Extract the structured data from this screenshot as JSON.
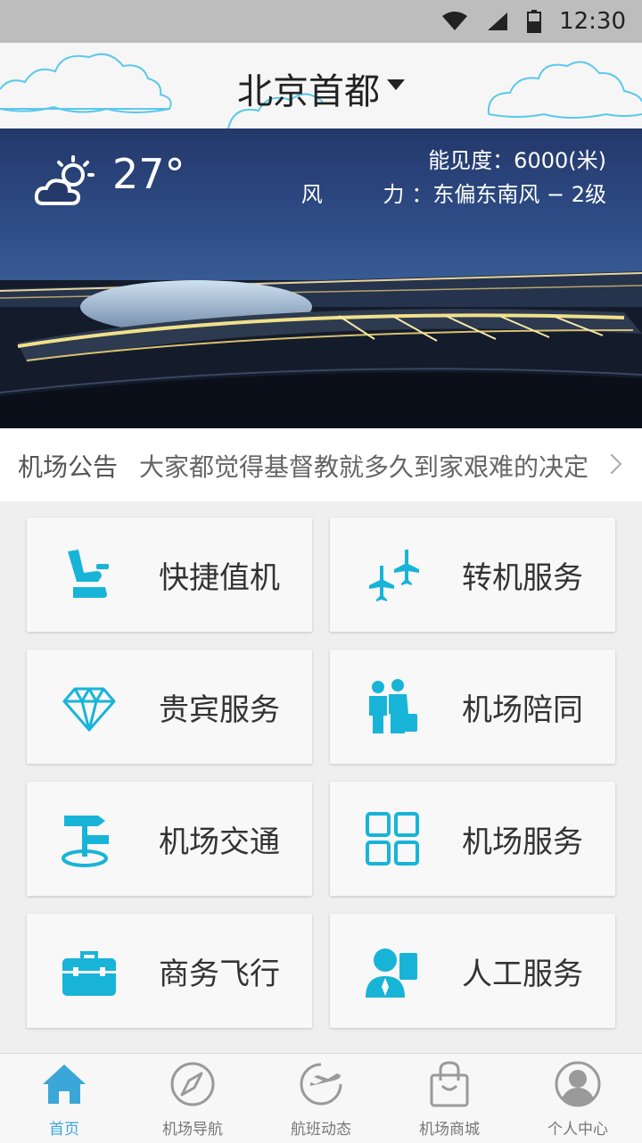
{
  "status_bar": {
    "time": "12:30"
  },
  "header": {
    "city": "北京首都"
  },
  "weather": {
    "temperature": "27°",
    "visibility": "能见度：6000(米)",
    "wind_label": "风 力",
    "wind_value": "：东偏东南风 − 2级"
  },
  "notice": {
    "label": "机场公告",
    "text": "大家都觉得基督教就多久到家艰难的决定"
  },
  "services": [
    {
      "label": "快捷值机",
      "icon": "seat-icon"
    },
    {
      "label": "转机服务",
      "icon": "planes-icon"
    },
    {
      "label": "贵宾服务",
      "icon": "diamond-icon"
    },
    {
      "label": "机场陪同",
      "icon": "escort-icon"
    },
    {
      "label": "机场交通",
      "icon": "signpost-icon"
    },
    {
      "label": "机场服务",
      "icon": "grid-icon"
    },
    {
      "label": "商务飞行",
      "icon": "briefcase-icon"
    },
    {
      "label": "人工服务",
      "icon": "agent-icon"
    }
  ],
  "tabs": [
    {
      "label": "首页",
      "icon": "home-icon"
    },
    {
      "label": "机场导航",
      "icon": "compass-icon"
    },
    {
      "label": "航班动态",
      "icon": "flight-status-icon"
    },
    {
      "label": "机场商城",
      "icon": "shopping-bag-icon"
    },
    {
      "label": "个人中心",
      "icon": "user-icon"
    }
  ],
  "colors": {
    "accent": "#18b4d8",
    "tab_active": "#3aa7d8",
    "tab_inactive": "#9a9a9a"
  }
}
